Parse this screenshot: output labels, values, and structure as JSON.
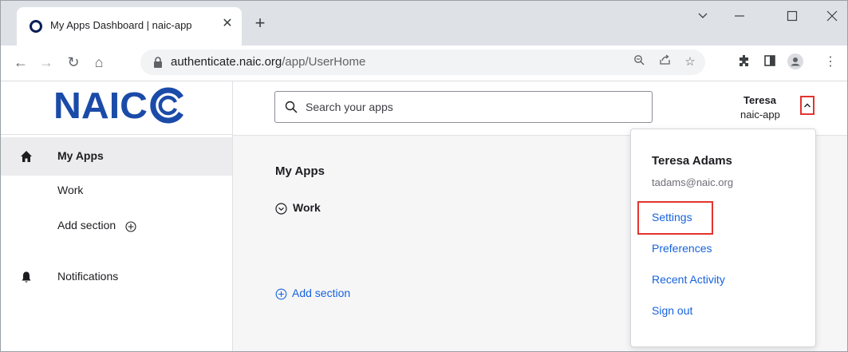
{
  "browser": {
    "tab_title": "My Apps Dashboard | naic-app",
    "url_host": "authenticate.naic.org",
    "url_path": "/app/UserHome"
  },
  "logo_text": "NAIC",
  "sidebar": {
    "items": [
      {
        "label": "My Apps",
        "icon": "home-icon"
      },
      {
        "label": "Work"
      },
      {
        "label": "Add section"
      },
      {
        "label": "Notifications",
        "icon": "bell-icon"
      }
    ]
  },
  "search": {
    "placeholder": "Search your apps"
  },
  "user": {
    "first_name": "Teresa",
    "org": "naic-app"
  },
  "main": {
    "heading": "My Apps",
    "section": "Work",
    "add_section": "Add section"
  },
  "dropdown": {
    "name": "Teresa Adams",
    "email": "tadams@naic.org",
    "items": [
      "Settings",
      "Preferences",
      "Recent Activity",
      "Sign out"
    ]
  },
  "colors": {
    "accent": "#1662dd",
    "logo": "#1b4ba8",
    "highlight": "#e3342f"
  }
}
